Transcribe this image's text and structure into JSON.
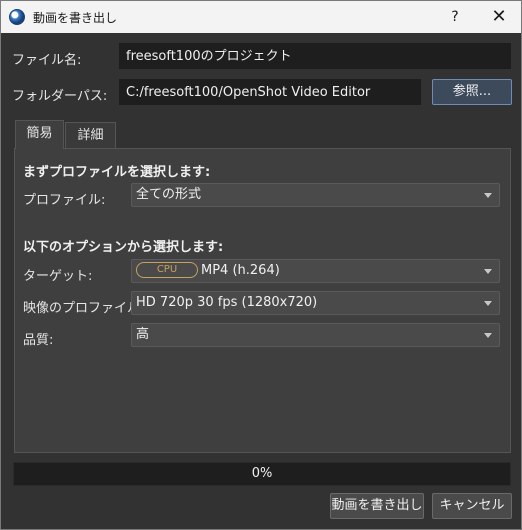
{
  "window": {
    "title": "動画を書き出し",
    "help": "?",
    "close": "✕"
  },
  "file": {
    "label": "ファイル名:",
    "value": "freesoft100のプロジェクト"
  },
  "folder": {
    "label": "フォルダーパス:",
    "value": "C:/freesoft100/OpenShot Video Editor",
    "browse_label": "参照..."
  },
  "tabs": [
    {
      "label": "簡易",
      "active": true
    },
    {
      "label": "詳細",
      "active": false
    }
  ],
  "simple": {
    "profile_heading": "まずプロファイルを選択します:",
    "profile_label": "プロファイル:",
    "profile_value": "全ての形式",
    "options_heading": "以下のオプションから選択します:",
    "target_label": "ターゲット:",
    "target_badge": "CPU",
    "target_value": "MP4 (h.264)",
    "video_profile_label": "映像のプロファイル:",
    "video_profile_value": "HD 720p 30 fps (1280x720)",
    "quality_label": "品質:",
    "quality_value": "高"
  },
  "progress": {
    "value": 0,
    "text": "0%"
  },
  "buttons": {
    "export": "動画を書き出し",
    "cancel": "キャンセル"
  }
}
